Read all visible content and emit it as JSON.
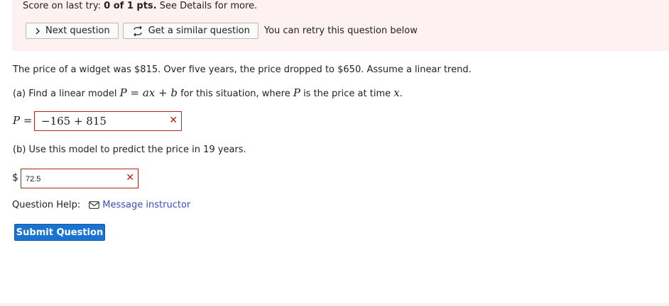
{
  "score": {
    "prefix": "Score on last try: ",
    "value": "0 of 1 pts.",
    "suffix": " See Details for more."
  },
  "buttons": {
    "next_question": "Next question",
    "similar_question": "Get a similar question",
    "retry_note": "You can retry this question below"
  },
  "question": {
    "intro": "The price of a widget was $815. Over five years, the price dropped to $650. Assume a linear trend.",
    "part_a_prefix": "(a) Find a linear model ",
    "part_a_formula": "P = ax + b",
    "part_a_middle": " for this situation, where ",
    "part_a_var_p": "P",
    "part_a_suffix": " is the price at time ",
    "part_a_var_x": "x",
    "part_a_end": ".",
    "answer_a_label": "P =",
    "answer_a_value": "−165 + 815",
    "part_b": "(b) Use this model to predict the price in 19 years.",
    "answer_b_currency": "$",
    "answer_b_value": "72.5"
  },
  "help": {
    "label": "Question Help:",
    "link": "Message instructor"
  },
  "submit_label": "Submit Question",
  "icons": {
    "next": "chevron-right-icon",
    "similar": "refresh-icon",
    "message": "envelope-icon",
    "incorrect": "x-mark-icon"
  },
  "colors": {
    "score_panel_bg": "#fdf1f1",
    "error_border": "#b32424",
    "link": "#3b4cc0",
    "submit_bg": "#1a73d0"
  }
}
